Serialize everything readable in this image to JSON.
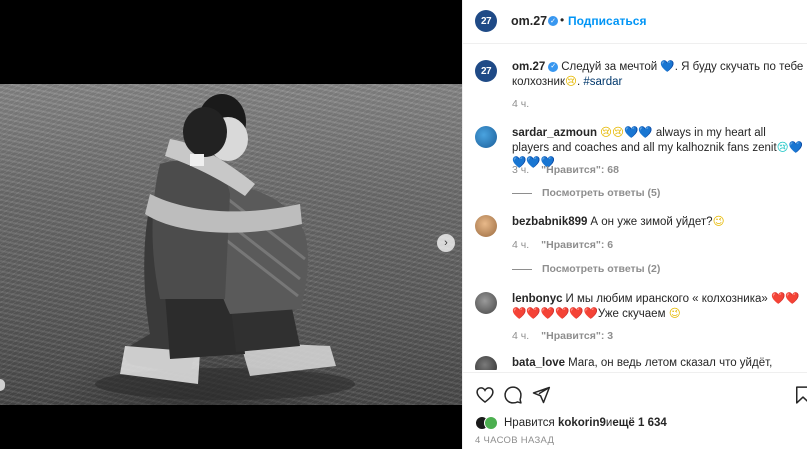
{
  "post": {
    "author": "om.27",
    "author_logo_text": "27",
    "follow_separator": "•",
    "follow_label": "Подписаться"
  },
  "caption": {
    "username": "om.27",
    "text_part1": "Следуй за мечтой ",
    "emoji_heart": "💙",
    "text_part2": ". Я буду скучать по тебе колхозник",
    "emoji_face": "😢",
    "text_part3": ". ",
    "hashtag": "#sardar",
    "time": "4 ч."
  },
  "comments": [
    {
      "username": "sardar_azmoun",
      "text_emoji1": "😢😢💙💙",
      "text": " always in my heart all players and coaches and all my kalhoznik fans zenit",
      "text_emoji2": "😢💙💙💙💙",
      "time": "3 ч.",
      "likes": "\"Нравится\": 68",
      "replies": "Посмотреть ответы (5)"
    },
    {
      "username": "bezbabnik899",
      "text": "А он уже зимой уйдет?",
      "text_emoji2": "😉",
      "time": "4 ч.",
      "likes": "\"Нравится\": 6",
      "replies": "Посмотреть ответы (2)"
    },
    {
      "username": "lenbonyc",
      "text": "И мы любим иранского « колхозника» ",
      "text_emoji_red": "❤️❤️❤️❤️❤️❤️❤️❤️",
      "text2": "Уже скучаем ",
      "text_emoji2": "😉",
      "time": "4 ч.",
      "likes": "\"Нравится\": 3"
    },
    {
      "username": "bata_love",
      "text": "Мага, он ведь летом сказал что уйдёт,"
    }
  ],
  "actions": {
    "likes_prefix": "Нравится",
    "likes_user": "kokorin9",
    "likes_mid": " и ",
    "likes_count": "ещё 1 634",
    "timestamp": "4 ЧАСОВ НАЗАД"
  },
  "icons": {
    "carousel_next": "chevron-right-icon",
    "like": "heart-icon",
    "comment": "comment-bubble-icon",
    "share": "paper-plane-icon",
    "save": "bookmark-icon"
  },
  "colors": {
    "accent_blue": "#0095f6",
    "verified_blue": "#3897f0",
    "logo_blue": "#1f4a86"
  }
}
